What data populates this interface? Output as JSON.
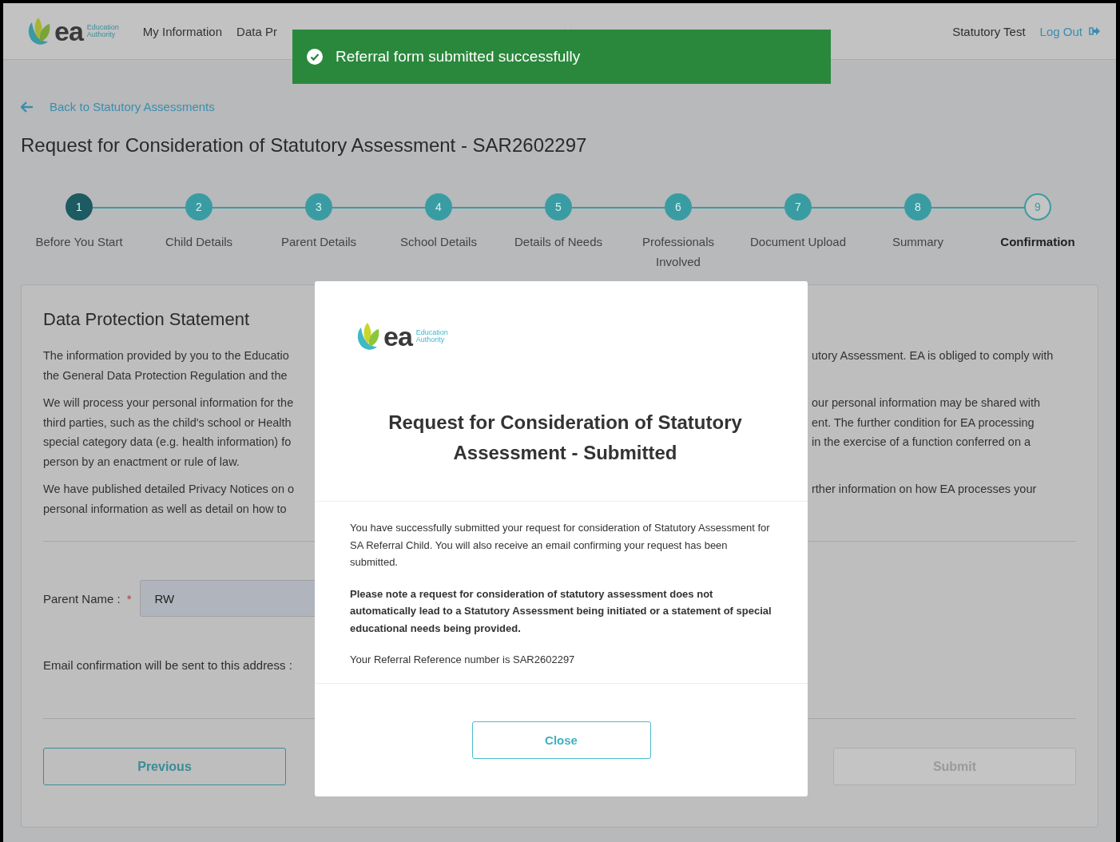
{
  "header": {
    "logo": {
      "mark": "ea",
      "line1": "Education",
      "line2": "Authority"
    },
    "nav": [
      "My Information",
      "Data Pr"
    ],
    "user": "Statutory Test",
    "logout": "Log Out"
  },
  "toast": {
    "message": "Referral form submitted successfully"
  },
  "back_link": "Back to Statutory Assessments",
  "page_title": "Request for Consideration of Statutory Assessment - SAR2602297",
  "steps": [
    {
      "number": "1",
      "label": "Before You Start",
      "kind": "highlighted"
    },
    {
      "number": "2",
      "label": "Child Details",
      "kind": "complete"
    },
    {
      "number": "3",
      "label": "Parent Details",
      "kind": "complete"
    },
    {
      "number": "4",
      "label": "School Details",
      "kind": "complete"
    },
    {
      "number": "5",
      "label": "Details of Needs",
      "kind": "complete"
    },
    {
      "number": "6",
      "label": "Professionals Involved",
      "kind": "complete"
    },
    {
      "number": "7",
      "label": "Document Upload",
      "kind": "complete"
    },
    {
      "number": "8",
      "label": "Summary",
      "kind": "complete"
    },
    {
      "number": "9",
      "label": "Confirmation",
      "kind": "current"
    }
  ],
  "statement": {
    "title": "Data Protection Statement",
    "paragraphs": [
      {
        "lines": [
          {
            "left": "The information provided by you to the Educatio",
            "right": "utory Assessment. EA is obliged to comply with"
          },
          {
            "left": "the General Data Protection Regulation and the"
          }
        ]
      },
      {
        "lines": [
          {
            "left": "We will process your personal information for the",
            "right": "our personal information may be shared with"
          },
          {
            "left": "third parties, such as the child's school or Health",
            "right": "ent. The further condition for EA processing"
          },
          {
            "left": "special category data (e.g. health information) fo",
            "right": "in the exercise of a function conferred on a"
          },
          {
            "left": "person by an enactment or rule of law."
          }
        ]
      },
      {
        "lines": [
          {
            "left": "We have published detailed Privacy Notices on o",
            "right": "rther information on how EA processes your"
          },
          {
            "left": "personal information as well as detail on how to"
          }
        ]
      }
    ]
  },
  "form": {
    "parent_name": {
      "label": "Parent Name :",
      "required": true,
      "required_marker": "*",
      "value": "RW"
    },
    "email_label": "Email confirmation will be sent to this address :"
  },
  "buttons": {
    "previous": "Previous",
    "submit": {
      "label": "Submit",
      "disabled": true
    }
  },
  "modal": {
    "logo": {
      "mark": "ea",
      "line1": "Education",
      "line2": "Authority"
    },
    "title": "Request for Consideration of Statutory Assessment - Submitted",
    "message": "You have successfully submitted your request for consideration of Statutory Assessment for SA Referral Child. You will also receive an email confirming your request has been submitted.",
    "note": "Please note a request for consideration of statutory assessment does not automatically lead to a Statutory Assessment being initiated or a statement of special educational needs being provided.",
    "reference": "Your Referral Reference number is SAR2602297",
    "close": "Close"
  }
}
